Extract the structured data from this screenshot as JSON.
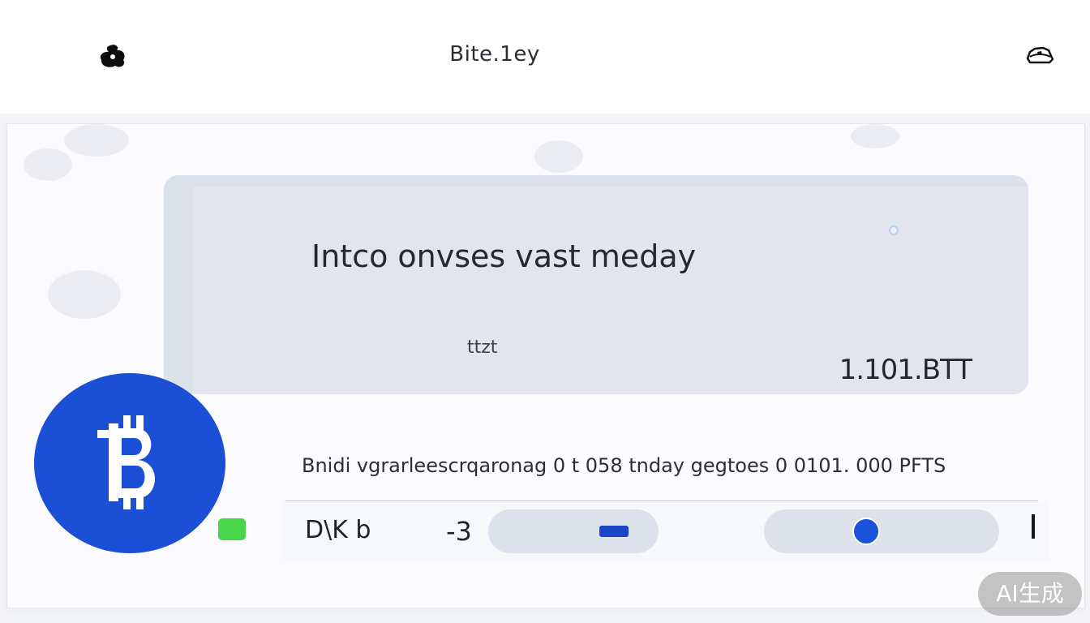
{
  "header": {
    "app_title": "Bite.1ey",
    "logo_icon": "logo-blob-icon",
    "menu_icon": "hat-icon"
  },
  "card": {
    "headline": "Intco onvses vast meday",
    "sublabel": "ttzt",
    "amount": "1.101.BTT"
  },
  "coin": {
    "icon": "bitcoin-icon",
    "color": "#1a4fd6"
  },
  "status": {
    "color": "#4ad64a"
  },
  "ticker": {
    "text": "Bnidi vgrarleescrqaronag 0 t 058 tnday gegtoes 0 0101. 000 PFTS"
  },
  "controls": {
    "label": "D\\K b",
    "value": "-3",
    "slider_level": 0.42,
    "accent": "#1a52dc"
  },
  "watermark": {
    "text": "AI生成"
  }
}
